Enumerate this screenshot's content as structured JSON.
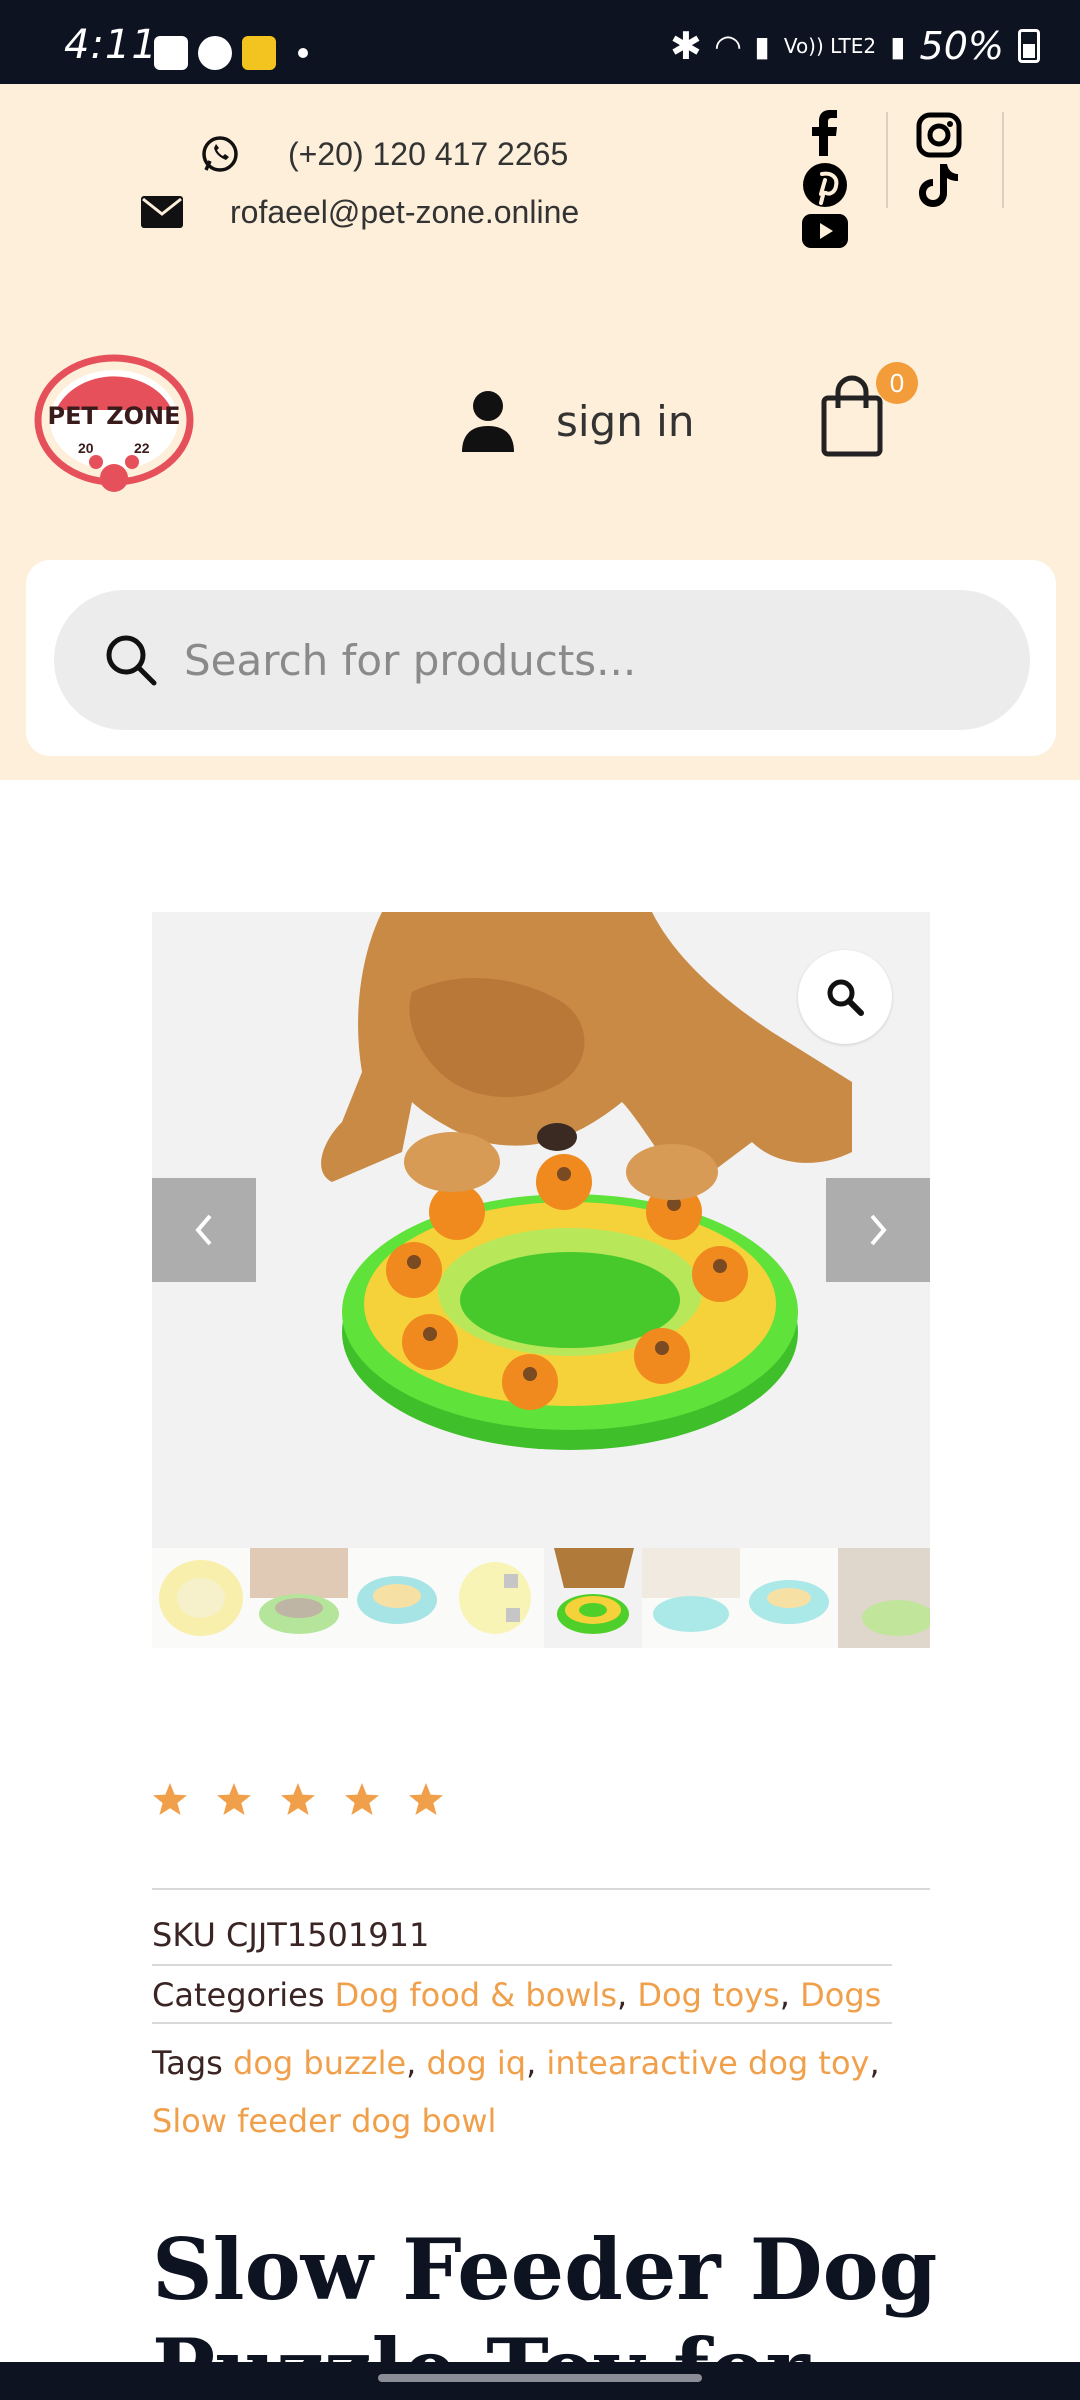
{
  "status_bar": {
    "time": "4:11",
    "battery": "50%",
    "network_label": "Vo)) LTE2"
  },
  "contact": {
    "phone": "(+20) 120 417 2265",
    "email": "rofaeel@pet-zone.online"
  },
  "logo": {
    "text": "PET ZONE",
    "year_left": "20",
    "year_right": "22"
  },
  "header": {
    "signin_label": "sign in",
    "cart_count": "0"
  },
  "search": {
    "placeholder": "Search for products..."
  },
  "gallery": {
    "thumbnail_count": 8,
    "active_thumbnail_index": 4
  },
  "product": {
    "rating": 5,
    "sku_label": "SKU",
    "sku": "CJJT1501911",
    "categories_label": "Categories",
    "categories": [
      "Dog food & bowls",
      "Dog toys",
      "Dogs"
    ],
    "tags_label": "Tags",
    "tags": [
      "dog buzzle",
      "dog iq",
      "intearactive dog toy",
      "Slow feeder dog bowl"
    ],
    "title": "Slow Feeder Dog Puzzle Toy for"
  },
  "colors": {
    "accent": "#f0a04b",
    "cream": "#fdefd9",
    "dark": "#0e1321"
  }
}
